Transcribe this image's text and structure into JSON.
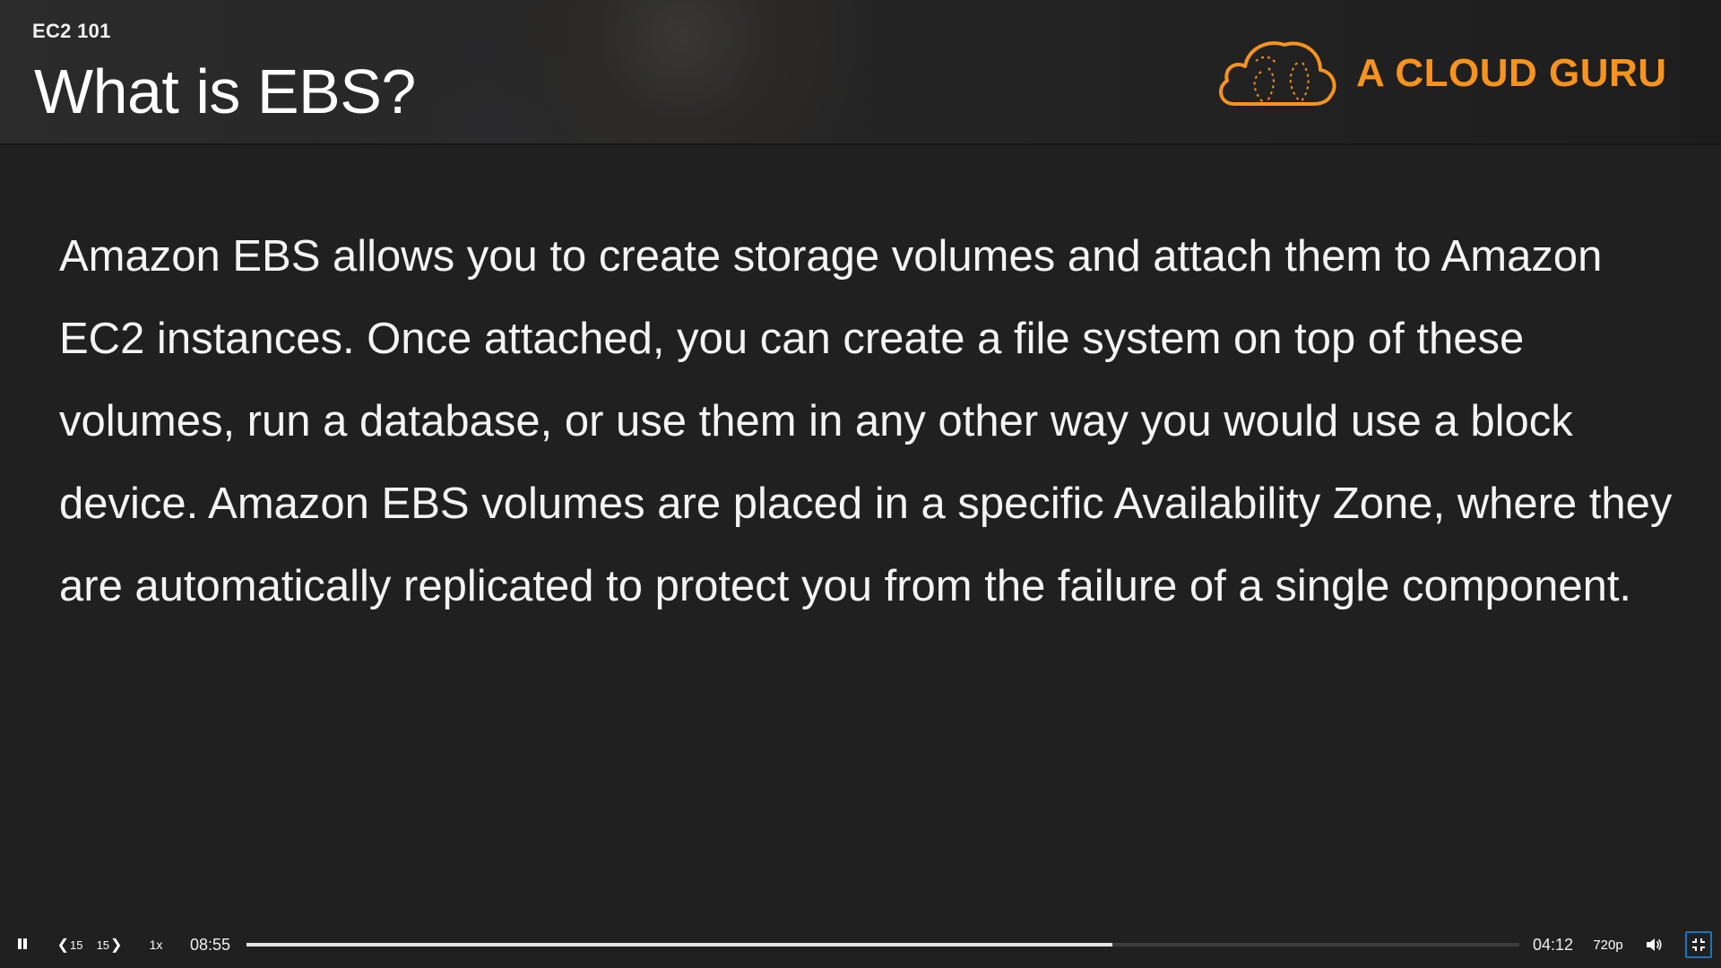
{
  "header": {
    "course_label": "EC2 101",
    "title": "What is EBS?",
    "brand": "A CLOUD GURU",
    "brand_color": "#f7931e"
  },
  "slide": {
    "body": "Amazon EBS allows you to create storage volumes and attach them to Amazon EC2 instances. Once attached, you can create a file system on top of these volumes, run a database, or use them in any other way you would use a block device. Amazon EBS volumes are placed in a specific Availability Zone, where they are automatically replicated to protect you from the failure of a single component."
  },
  "player": {
    "play_state_icon": "pause-icon",
    "rewind_label": "15",
    "forward_label": "15",
    "speed_label": "1x",
    "time_current": "08:55",
    "time_remaining": "04:12",
    "progress_fraction": 0.68,
    "quality_label": "720p",
    "volume_icon": "speaker-icon",
    "fullscreen_icon": "exit-fullscreen-icon"
  }
}
